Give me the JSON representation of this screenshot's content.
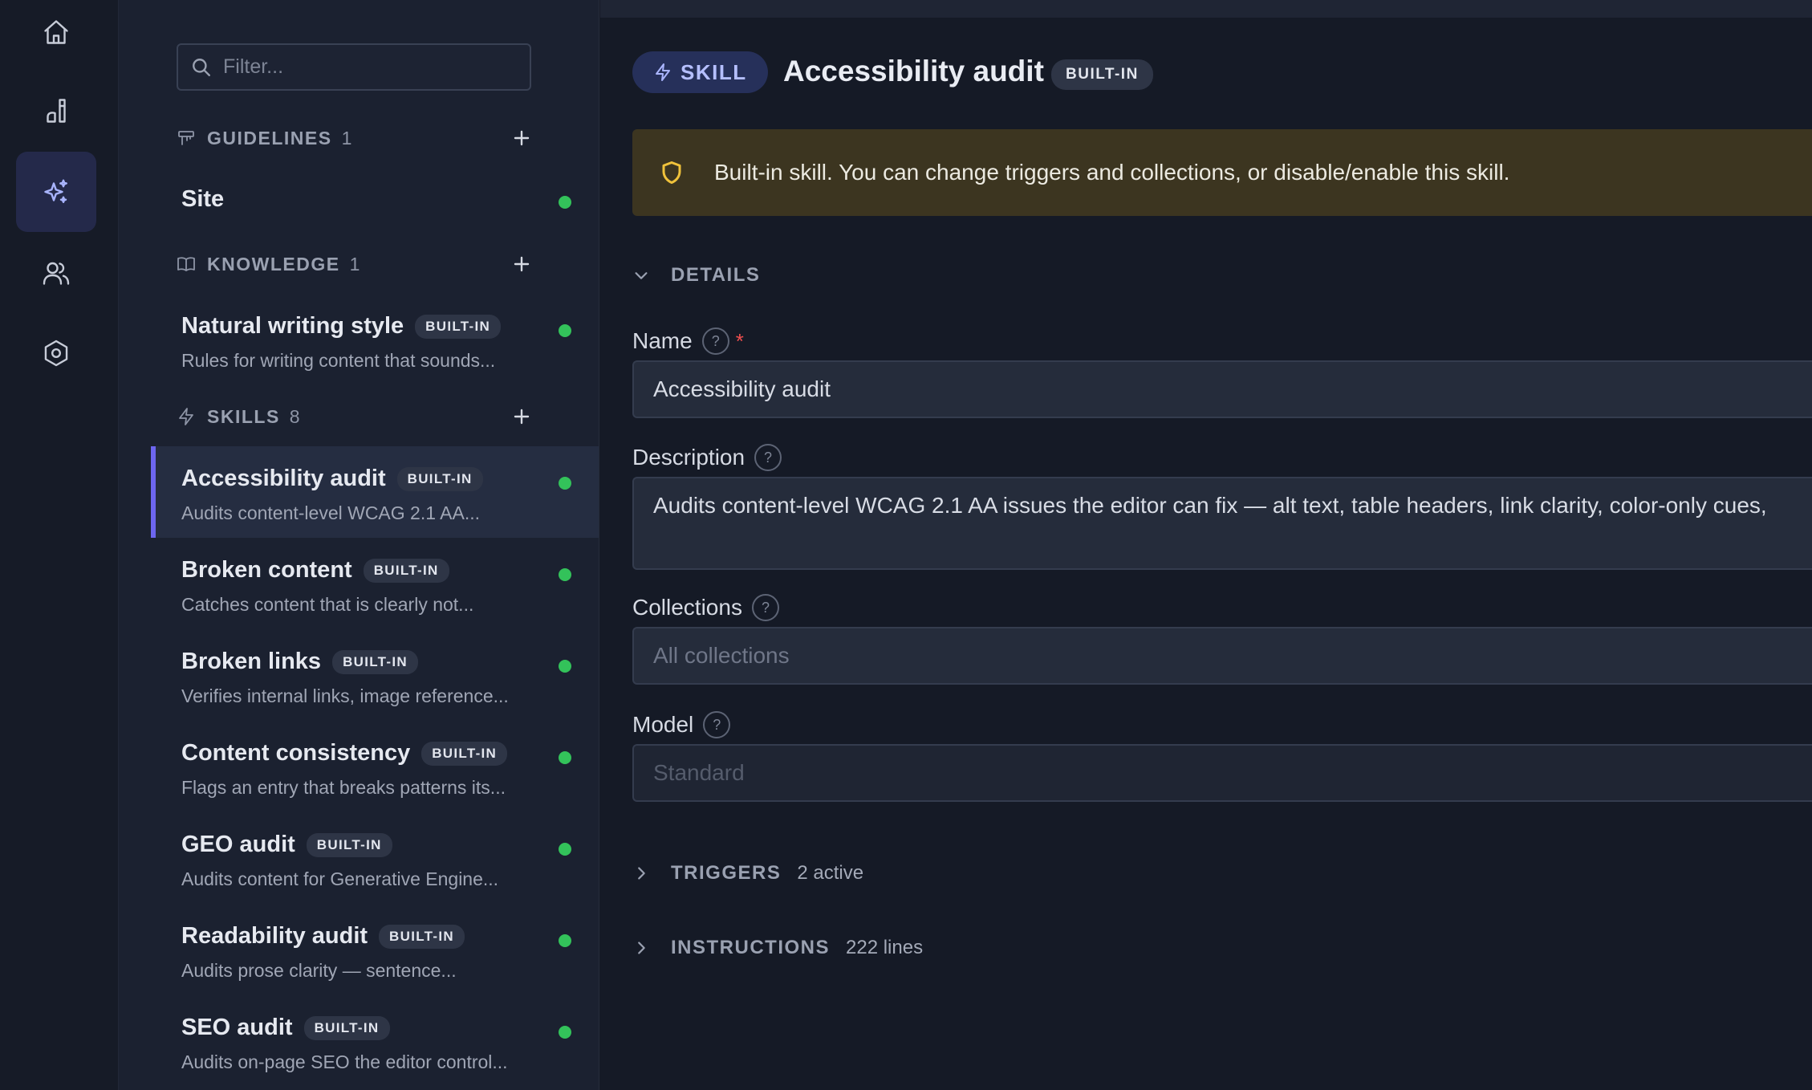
{
  "rail": {
    "items": [
      {
        "icon": "home-icon",
        "active": false
      },
      {
        "icon": "brush-icon",
        "active": false
      },
      {
        "icon": "sparkles-icon",
        "active": true
      },
      {
        "icon": "users-icon",
        "active": false
      },
      {
        "icon": "settings-icon",
        "active": false
      }
    ]
  },
  "sidebar": {
    "filter_placeholder": "Filter...",
    "guidelines": {
      "title": "GUIDELINES",
      "count": "1",
      "items": [
        {
          "title": "Site"
        }
      ]
    },
    "knowledge": {
      "title": "KNOWLEDGE",
      "count": "1",
      "items": [
        {
          "title": "Natural writing style",
          "badge": "BUILT-IN",
          "desc": "Rules for writing content that sounds..."
        }
      ]
    },
    "skills": {
      "title": "SKILLS",
      "count": "8",
      "items": [
        {
          "title": "Accessibility audit",
          "badge": "BUILT-IN",
          "desc": "Audits content-level WCAG 2.1 AA..."
        },
        {
          "title": "Broken content",
          "badge": "BUILT-IN",
          "desc": "Catches content that is clearly not..."
        },
        {
          "title": "Broken links",
          "badge": "BUILT-IN",
          "desc": "Verifies internal links, image reference..."
        },
        {
          "title": "Content consistency",
          "badge": "BUILT-IN",
          "desc": "Flags an entry that breaks patterns its..."
        },
        {
          "title": "GEO audit",
          "badge": "BUILT-IN",
          "desc": "Audits content for Generative Engine..."
        },
        {
          "title": "Readability audit",
          "badge": "BUILT-IN",
          "desc": "Audits prose clarity — sentence..."
        },
        {
          "title": "SEO audit",
          "badge": "BUILT-IN",
          "desc": "Audits on-page SEO the editor control..."
        }
      ]
    }
  },
  "main": {
    "type_label": "SKILL",
    "title": "Accessibility audit",
    "title_badge": "BUILT-IN",
    "banner": "Built-in skill. You can change triggers and collections, or disable/enable this skill.",
    "details": {
      "title": "DETAILS"
    },
    "fields": {
      "name": {
        "label": "Name",
        "required": "*",
        "value": "Accessibility audit"
      },
      "description": {
        "label": "Description",
        "value": "Audits content-level WCAG 2.1 AA issues the editor can fix — alt text, table headers, link clarity, color-only cues,"
      },
      "collections": {
        "label": "Collections",
        "placeholder": "All collections"
      },
      "model": {
        "label": "Model",
        "placeholder": "Standard"
      }
    },
    "triggers": {
      "title": "TRIGGERS",
      "count": "2 active"
    },
    "instructions": {
      "title": "INSTRUCTIONS",
      "count": "222 lines"
    }
  },
  "colors": {
    "accent": "#6d66f0",
    "status_active": "#33c25a",
    "warning": "#f0c23b",
    "required": "#ef4f4f"
  }
}
